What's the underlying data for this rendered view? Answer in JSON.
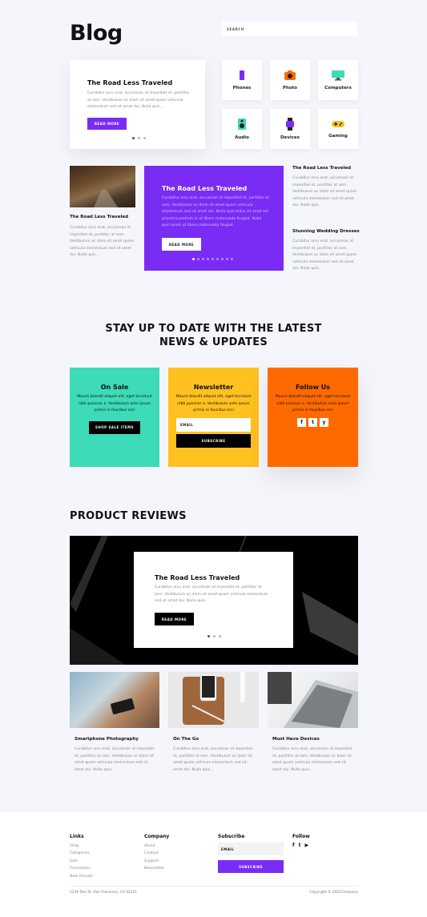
{
  "header": {
    "title": "Blog",
    "search_placeholder": "SEARCH"
  },
  "hero_slider": {
    "title": "The Road Less Traveled",
    "text": "Curabitur arcu erat, accumsan id imperdiet et, porttitor at sem. Vestibulum ac diam sit amet quam vehicula elementum sed sit amet dui. Nulla quis...",
    "button": "READ MORE"
  },
  "categories": [
    {
      "label": "Phones",
      "icon": "phone-icon",
      "color": "#7a2cf5"
    },
    {
      "label": "Photo",
      "icon": "camera-icon",
      "color": "#ff6a00"
    },
    {
      "label": "Computers",
      "icon": "monitor-icon",
      "color": "#3ddbb7"
    },
    {
      "label": "Audio",
      "icon": "speaker-icon",
      "color": "#3ddbb7"
    },
    {
      "label": "Devices",
      "icon": "watch-icon",
      "color": "#7a2cf5"
    },
    {
      "label": "Gaming",
      "icon": "gamepad-icon",
      "color": "#ffc11f"
    }
  ],
  "featured": {
    "left": {
      "title": "The Road Less Traveled",
      "text": "Curabitur arcu erat, accumsan id imperdiet et, porttitor at sem. Vestibulum ac diam sit amet quam vehicula elementum sed sit amet dui. Nulla quis..."
    },
    "center": {
      "title": "The Road Less Traveled",
      "text": "Curabitur arcu erat, accumsan id imperdiet et, porttitor at sem. Vestibulum ac diam sit amet quam vehicula elementum sed sit amet dui. Nulla quis tellus sit amet est pharetra pretium in ut libero malesuada feugiat. Nulla quis lorem ut libero malesuada feugiat.",
      "button": "READ MORE"
    },
    "right": [
      {
        "title": "The Road Less Traveled",
        "text": "Curabitur arcu erat, accumsan id imperdiet et, porttitor at sem. Vestibulum ac diam sit amet quam vehicula elementum sed sit amet dui. Nulla quis..."
      },
      {
        "title": "Stunning Wedding Dresses",
        "text": "Curabitur arcu erat, accumsan id imperdiet et, porttitor at sem. Vestibulum ac diam sit amet quam vehicula elementum sed sit amet dui. Nulla quis..."
      }
    ]
  },
  "newsletter_section": {
    "heading_line1": "STAY UP TO DATE WITH THE LATEST",
    "heading_line2": "NEWS & UPDATES",
    "on_sale": {
      "title": "On Sale",
      "text": "Mauris blandit aliquet elit, eget tincidunt nibh pulvinar a. Vestibulum ante ipsum primis in faucibus orci",
      "button": "SHOP SALE ITEMS"
    },
    "newsletter": {
      "title": "Newsletter",
      "text": "Mauris blandit aliquet elit, eget tincidunt nibh pulvinar a. Vestibulum ante ipsum primis in faucibus orci",
      "email_placeholder": "EMAIL",
      "button": "SUBSCRIBE"
    },
    "follow": {
      "title": "Follow Us",
      "text": "Mauris blandit aliquet elit, eget tincidunt nibh pulvinar a. Vestibulum ante ipsum primis in faucibus orci",
      "icons": [
        "f",
        "t",
        "y"
      ]
    }
  },
  "reviews": {
    "heading": "PRODUCT REVIEWS",
    "hero": {
      "title": "The Road Less Traveled",
      "text": "Curabitur arcu erat, accumsan id imperdiet et, porttitor at sem. Vestibulum ac diam sit amet quam vehicula elementum sed sit amet dui. Nulla quis...",
      "button": "READ MORE"
    },
    "cards": [
      {
        "title": "Smartphone Photography",
        "text": "Curabitur arcu erat, accumsan id imperdiet et, porttitor at sem. Vestibulum ac diam sit amet quam vehicula elementum sed sit amet dui. Nulla quis..."
      },
      {
        "title": "On The Go",
        "text": "Curabitur arcu erat, accumsan id imperdiet et, porttitor at sem. Vestibulum ac diam sit amet quam vehicula elementum sed sit amet dui. Nulla quis..."
      },
      {
        "title": "Must Have Devices",
        "text": "Curabitur arcu erat, accumsan id imperdiet et, porttitor at sem. Vestibulum ac diam sit amet quam vehicula elementum sed sit amet dui. Nulla quis..."
      }
    ]
  },
  "footer": {
    "links_title": "Links",
    "links": [
      "Shop",
      "Categories",
      "Sale",
      "Promotions",
      "New Arrivals"
    ],
    "company_title": "Company",
    "company": [
      "About",
      "Contact",
      "Support",
      "Newsletter"
    ],
    "subscribe_title": "Subscribe",
    "email_placeholder": "EMAIL",
    "subscribe_button": "SUBSCRIBE",
    "follow_title": "Follow",
    "address": "1239 Divi St. San Francisco, CA 92351",
    "copyright": "Copyright © 2021Company"
  },
  "colors": {
    "purple": "#7a2cf5",
    "teal": "#3ddbb7",
    "yellow": "#ffc11f",
    "orange": "#ff6a00",
    "black": "#000000"
  }
}
